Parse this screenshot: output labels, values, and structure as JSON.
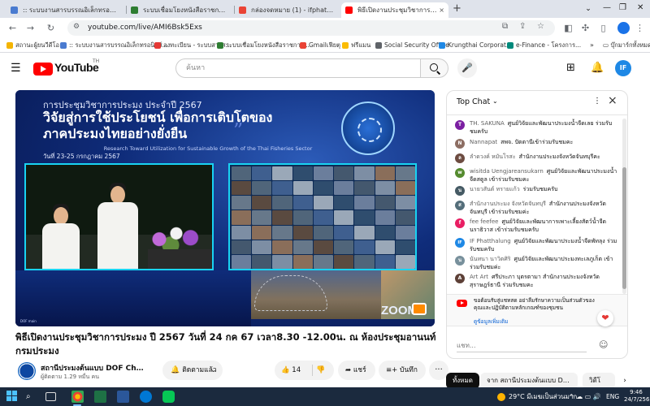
{
  "browser": {
    "tabs": [
      {
        "title": ":: ระบบงานสารบรรณอิเล็กทรอนิกส์ (e-Office) ::",
        "favicon_color": "#4a7bd0",
        "active": false
      },
      {
        "title": "ระบบเชื่อมโยงหนังสือราชการสำนักงาน",
        "favicon_color": "#2e7d32",
        "active": false
      },
      {
        "title": "กล่องจดหมาย (1) - ifphatthalung@",
        "favicon_color": "#ea4335",
        "active": false
      },
      {
        "title": "พิธีเปิดงานประชุมวิชาการประมง",
        "favicon_color": "#ff0000",
        "active": true
      }
    ],
    "new_tab": "+",
    "tab_close": "×",
    "tab_list": "⌄",
    "window_controls": [
      "—",
      "❐",
      "✕"
    ]
  },
  "toolbar": {
    "back": "←",
    "forward": "→",
    "reload": "↻",
    "url": "youtube.com/live/AMI6Bsk5Exs",
    "site_icon": "site-info-icon"
  },
  "bookmarks": {
    "items": [
      {
        "label": "สถานะผู้ยนวีดีโอ",
        "color": "#f4b400"
      },
      {
        "label": ":: ระบบงานสารบรรณอิเล็กทรอนิกส์...",
        "color": "#4a7bd0"
      },
      {
        "label": "ลงทะเบียน - ระบบสารส...",
        "color": "#e53935"
      },
      {
        "label": "ระบบเชื่อมโยงหนังสือราชการ...",
        "color": "#2e7d32"
      },
      {
        "label": "Gmailเฟียตุ",
        "color": "#ea4335"
      },
      {
        "label": "ฟรีแมน",
        "color": "#fbbc04"
      },
      {
        "label": "Social Security Office",
        "color": "#5f6368"
      },
      {
        "label": "Krungthai Corporat...",
        "color": "#1e88e5"
      },
      {
        "label": "e-Finance - โครงการ...",
        "color": "#00897b"
      }
    ],
    "more": "»",
    "all_bookmarks": "บุ๊กมาร์กทั้งหมด"
  },
  "masthead": {
    "logo_text": "YouTube",
    "country_code": "TH",
    "search_placeholder": "ค้นหา",
    "avatar_initials": "IF"
  },
  "video": {
    "banner_top": "การประชุมวิชาการประมง ประจำปี 2567",
    "banner_headline": "วิจัยสู่การใช้ประโยชน์ เพื่อการเติบโตของภาคประมงไทยอย่างยั่งยืน",
    "banner_subtitle": "Research Toward Utilization for Sustainable Growth of the Thai Fisheries Sector",
    "banner_date": "วันที่ 23-25 กรกฎาคม 2567",
    "watermark_left": "DOF main",
    "watermark_zoom": "ZOOM",
    "title": "พิธีเปิดงานประชุมวิชาการประมง ปี 2567 วันที่ 24 กค 67 เวลา8.30 -12.00น. ณ ห้องประชุมอานนท์ กรมประมง"
  },
  "channel": {
    "name": "สถานีประมงต้นแบบ DOF Channel",
    "subscribers": "ผู้ติดตาม 1.29 หมื่น คน",
    "subscribe_label": "ติดตามแล้ว",
    "like_count": "14",
    "share_label": "แชร์",
    "save_label": "บันทึก",
    "more": "···"
  },
  "chat": {
    "header": "Top Chat",
    "messages": [
      {
        "author": "TH. SAKUNA",
        "text": "ศูนย์วิจัยและพัฒนาประมงน้ำจืดเลย ร่วมรับชมครับ",
        "color": "#7b1fa2",
        "initial": "T"
      },
      {
        "author": "Nannapat",
        "text": "สพจ. ปัตตานีเข้าร่วมรับชมคะ",
        "color": "#8d6e63",
        "initial": "N"
      },
      {
        "author": "ลำดวงค์ หมันโรสะ",
        "text": "สำนักงานประมงจังหวัดจันทบุรีคะ",
        "color": "#6d4c41",
        "initial": "ล"
      },
      {
        "author": "wisitda Uengjareansukarn",
        "text": "ศูนย์วิจัยและพัฒนาประมงน้ำจืดสตูล เข้าร่วมรับชมคะ",
        "color": "#558b2f",
        "initial": "w"
      },
      {
        "author": "นายวสันต์ ทรายแก้ว",
        "text": "ร่วมรับชมครับ",
        "color": "#455a64",
        "initial": "น"
      },
      {
        "author": "สำนักงานประมง จังหวัดจันทบุรี",
        "text": "สำนักงานประมงจังหวัดจันทบุรี เข้าร่วมรับชมค่ะ",
        "color": "#546e7a",
        "initial": "ส"
      },
      {
        "author": "fee feefee",
        "text": "ศูนย์วิจัยและพัฒนาการเพาะเลี้ยงสัตว์น้ำจืดนราธิวาส เข้าร่วมรับชมครับ",
        "color": "#e91e63",
        "initial": "f"
      },
      {
        "author": "IF Phatthalung",
        "text": "ศูนย์วิจัยและพัฒนาประมงน้ำจืดพัทลุง ร่วมรับชมครับ",
        "color": "#1e88e5",
        "initial": "IF"
      },
      {
        "author": "นันทนา นาวิตศิริ",
        "text": "ศูนย์วิจัยและพัฒนาประมงทะเลภูเก็ต เข้าร่วมรับชมค่ะ",
        "color": "#78909c",
        "initial": "น"
      },
      {
        "author": "Art Art",
        "text": "ศรีประภา บุตรตามา สำนักงานประมงจังหวัดสุราษฎร์ธานี ร่วมรับชมคะ",
        "color": "#5d4037",
        "initial": "A"
      }
    ],
    "notice_text": "ขอต้อนรับสู่แชทสด อย่าลืมรักษาความเป็นส่วนตัวของคุณและปฏิบัติตามหลักเกณฑ์ของชุมชน",
    "notice_link": "ดูข้อมูลเพิ่มเติม",
    "input_placeholder": "แชท..."
  },
  "chips": {
    "all": "ทั้งหมด",
    "from_channel": "จาก สถานีประมงต้นแบบ DOF Ch...",
    "video": "วิดีโ"
  },
  "taskbar": {
    "weather": "29°C มีเมฆเป็นส่วนมาก",
    "tray": "^ ☁ ▭ 🔊",
    "lang": "ENG",
    "time": "9:46",
    "date": "24/7/2567"
  },
  "colors": {
    "youtube_red": "#ff0000",
    "link_blue": "#065fd4",
    "banner_bg": "#0f2c7a",
    "camera_frame": "#19d3f2"
  }
}
